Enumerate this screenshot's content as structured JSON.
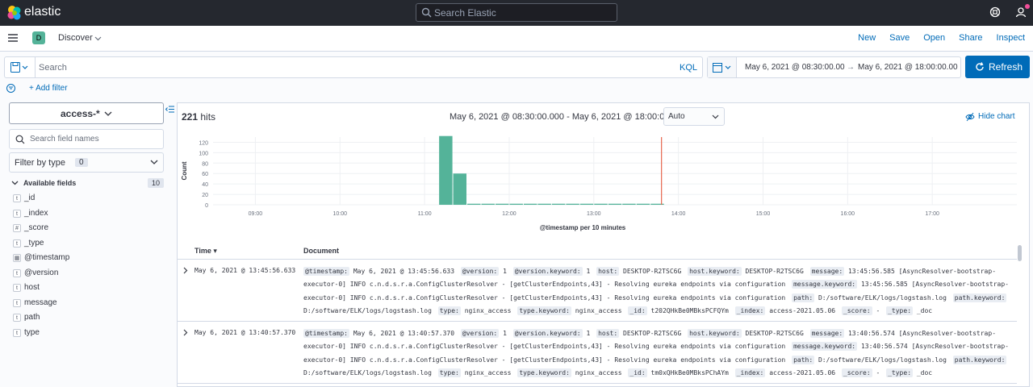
{
  "header": {
    "brand": "elastic",
    "search_placeholder": "Search Elastic",
    "icons": [
      "elastic-logo-icon",
      "search-icon",
      "help-icon",
      "user-icon"
    ]
  },
  "appbar": {
    "space_letter": "D",
    "breadcrumb": "Discover",
    "links": [
      "New",
      "Save",
      "Open",
      "Share",
      "Inspect"
    ]
  },
  "query": {
    "placeholder": "Search",
    "language": "KQL",
    "date_start": "May 6, 2021 @ 08:30:00.00",
    "date_arrow": "→",
    "date_end": "May 6, 2021 @ 18:00:00.00",
    "refresh_label": "Refresh",
    "add_filter": "+ Add filter"
  },
  "sidebar": {
    "index_pattern": "access-*",
    "field_search_placeholder": "Search field names",
    "filter_by_type": "Filter by type",
    "filter_count": "0",
    "available_label": "Available fields",
    "available_count": "10",
    "fields": [
      {
        "name": "_id",
        "type": "t"
      },
      {
        "name": "_index",
        "type": "t"
      },
      {
        "name": "_score",
        "type": "#"
      },
      {
        "name": "_type",
        "type": "t"
      },
      {
        "name": "@timestamp",
        "type": "date"
      },
      {
        "name": "@version",
        "type": "t"
      },
      {
        "name": "host",
        "type": "t"
      },
      {
        "name": "message",
        "type": "t"
      },
      {
        "name": "path",
        "type": "t"
      },
      {
        "name": "type",
        "type": "t"
      }
    ]
  },
  "results": {
    "hits_count": "221",
    "hits_label": "hits",
    "range": "May 6, 2021 @ 08:30:00.000 - May 6, 2021 @ 18:00:00.000",
    "interval": "Auto",
    "hide_chart": "Hide chart",
    "col_time": "Time",
    "col_document": "Document",
    "rows": [
      {
        "time": "May 6, 2021 @ 13:45:56.633",
        "pairs": [
          [
            "@timestamp:",
            "May 6, 2021 @ 13:45:56.633"
          ],
          [
            "@version:",
            "1"
          ],
          [
            "@version.keyword:",
            "1"
          ],
          [
            "host:",
            "DESKTOP-R2TSC6G"
          ],
          [
            "host.keyword:",
            "DESKTOP-R2TSC6G"
          ],
          [
            "message:",
            "13:45:56.585 [AsyncResolver-bootstrap-executor-0] INFO c.n.d.s.r.a.ConfigClusterResolver - [getClusterEndpoints,43] - Resolving eureka endpoints via configuration"
          ],
          [
            "message.keyword:",
            "13:45:56.585 [AsyncResolver-bootstrap-executor-0] INFO c.n.d.s.r.a.ConfigClusterResolver - [getClusterEndpoints,43] - Resolving eureka endpoints via configuration"
          ],
          [
            "path:",
            "D:/software/ELK/logs/logstash.log"
          ],
          [
            "path.keyword:",
            "D:/software/ELK/logs/logstash.log"
          ],
          [
            "type:",
            "nginx_access"
          ],
          [
            "type.keyword:",
            "nginx_access"
          ],
          [
            "_id:",
            "t202QHkBe0MBksPCFQYm"
          ],
          [
            "_index:",
            "access-2021.05.06"
          ],
          [
            "_score:",
            " - "
          ],
          [
            "_type:",
            "_doc"
          ]
        ]
      },
      {
        "time": "May 6, 2021 @ 13:40:57.370",
        "pairs": [
          [
            "@timestamp:",
            "May 6, 2021 @ 13:40:57.370"
          ],
          [
            "@version:",
            "1"
          ],
          [
            "@version.keyword:",
            "1"
          ],
          [
            "host:",
            "DESKTOP-R2TSC6G"
          ],
          [
            "host.keyword:",
            "DESKTOP-R2TSC6G"
          ],
          [
            "message:",
            "13:40:56.574 [AsyncResolver-bootstrap-executor-0] INFO c.n.d.s.r.a.ConfigClusterResolver - [getClusterEndpoints,43] - Resolving eureka endpoints via configuration"
          ],
          [
            "message.keyword:",
            "13:40:56.574 [AsyncResolver-bootstrap-executor-0] INFO c.n.d.s.r.a.ConfigClusterResolver - [getClusterEndpoints,43] - Resolving eureka endpoints via configuration"
          ],
          [
            "path:",
            "D:/software/ELK/logs/logstash.log"
          ],
          [
            "path.keyword:",
            "D:/software/ELK/logs/logstash.log"
          ],
          [
            "type:",
            "nginx_access"
          ],
          [
            "type.keyword:",
            "nginx_access"
          ],
          [
            "_id:",
            "tm0xQHkBe0MBksPChAYm"
          ],
          [
            "_index:",
            "access-2021.05.06"
          ],
          [
            "_score:",
            " - "
          ],
          [
            "_type:",
            "_doc"
          ]
        ]
      }
    ]
  },
  "chart_data": {
    "type": "bar",
    "xlabel": "@timestamp per 10 minutes",
    "ylabel": "Count",
    "ylim": [
      0,
      130
    ],
    "yticks": [
      0,
      20,
      40,
      60,
      80,
      100,
      120
    ],
    "xticks": [
      "09:00",
      "10:00",
      "11:00",
      "12:00",
      "13:00",
      "14:00",
      "15:00",
      "16:00",
      "17:00"
    ],
    "x_start_hour": 8.5,
    "x_end_hour": 18,
    "bucket_minutes": 10,
    "bars": [
      {
        "t": 11.167,
        "v": 132
      },
      {
        "t": 11.333,
        "v": 60
      },
      {
        "t": 11.5,
        "v": 2
      },
      {
        "t": 11.667,
        "v": 2
      },
      {
        "t": 11.833,
        "v": 2
      },
      {
        "t": 12.0,
        "v": 2
      },
      {
        "t": 12.167,
        "v": 2
      },
      {
        "t": 12.333,
        "v": 2
      },
      {
        "t": 12.5,
        "v": 2
      },
      {
        "t": 12.667,
        "v": 2
      },
      {
        "t": 12.833,
        "v": 2
      },
      {
        "t": 13.0,
        "v": 2
      },
      {
        "t": 13.167,
        "v": 2
      },
      {
        "t": 13.333,
        "v": 2
      },
      {
        "t": 13.5,
        "v": 2
      },
      {
        "t": 13.667,
        "v": 2
      }
    ],
    "now_marker_hour": 13.8,
    "bar_color": "#54b399",
    "marker_color": "#e7664c",
    "grid": true
  }
}
